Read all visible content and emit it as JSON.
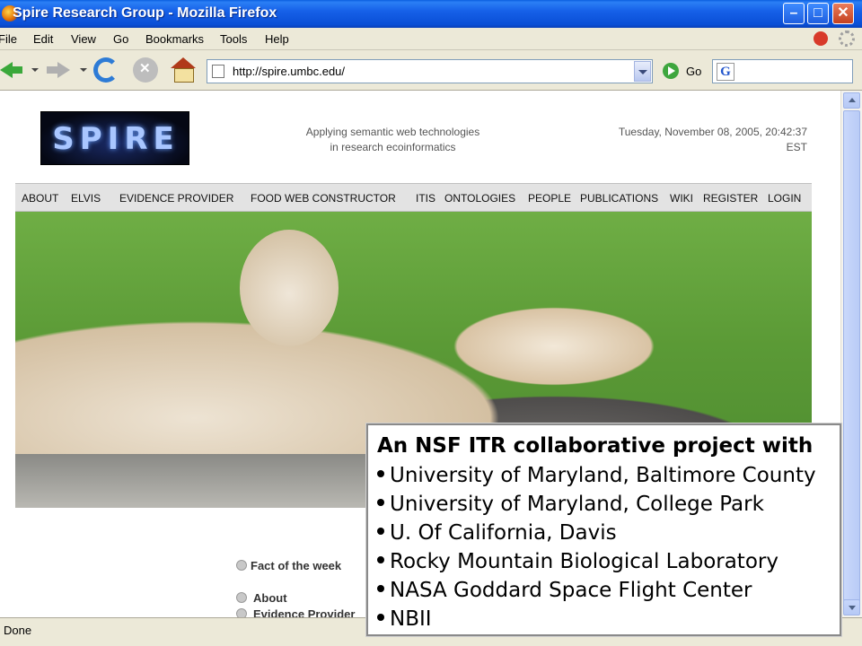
{
  "window": {
    "title": "Spire Research Group - Mozilla Firefox"
  },
  "menu": [
    "File",
    "Edit",
    "View",
    "Go",
    "Bookmarks",
    "Tools",
    "Help"
  ],
  "toolbar": {
    "url": "http://spire.umbc.edu/",
    "go_label": "Go"
  },
  "page": {
    "logo_text": "SPIRE",
    "tagline_line1": "Applying semantic web technologies",
    "tagline_line2": "in research ecoinformatics",
    "date_line1": "Tuesday, November 08, 2005, 20:42:37",
    "date_line2": "EST",
    "nav": [
      "ABOUT",
      "ELVIS",
      "EVIDENCE PROVIDER",
      "FOOD WEB CONSTRUCTOR",
      "ITIS",
      "ONTOLOGIES",
      "PEOPLE",
      "PUBLICATIONS",
      "WIKI",
      "REGISTER",
      "LOGIN"
    ],
    "fact_of_week": "Fact of the week",
    "about_link": "About",
    "evidence_link": "Evidence Provider"
  },
  "overlay": {
    "heading": "An NSF ITR collaborative project with",
    "items": [
      "University of Maryland, Baltimore County",
      "University of Maryland, College Park",
      "U. Of California, Davis",
      "Rocky Mountain Biological Laboratory",
      "NASA Goddard Space Flight Center",
      "NBII"
    ]
  },
  "status": {
    "text": "Done"
  }
}
